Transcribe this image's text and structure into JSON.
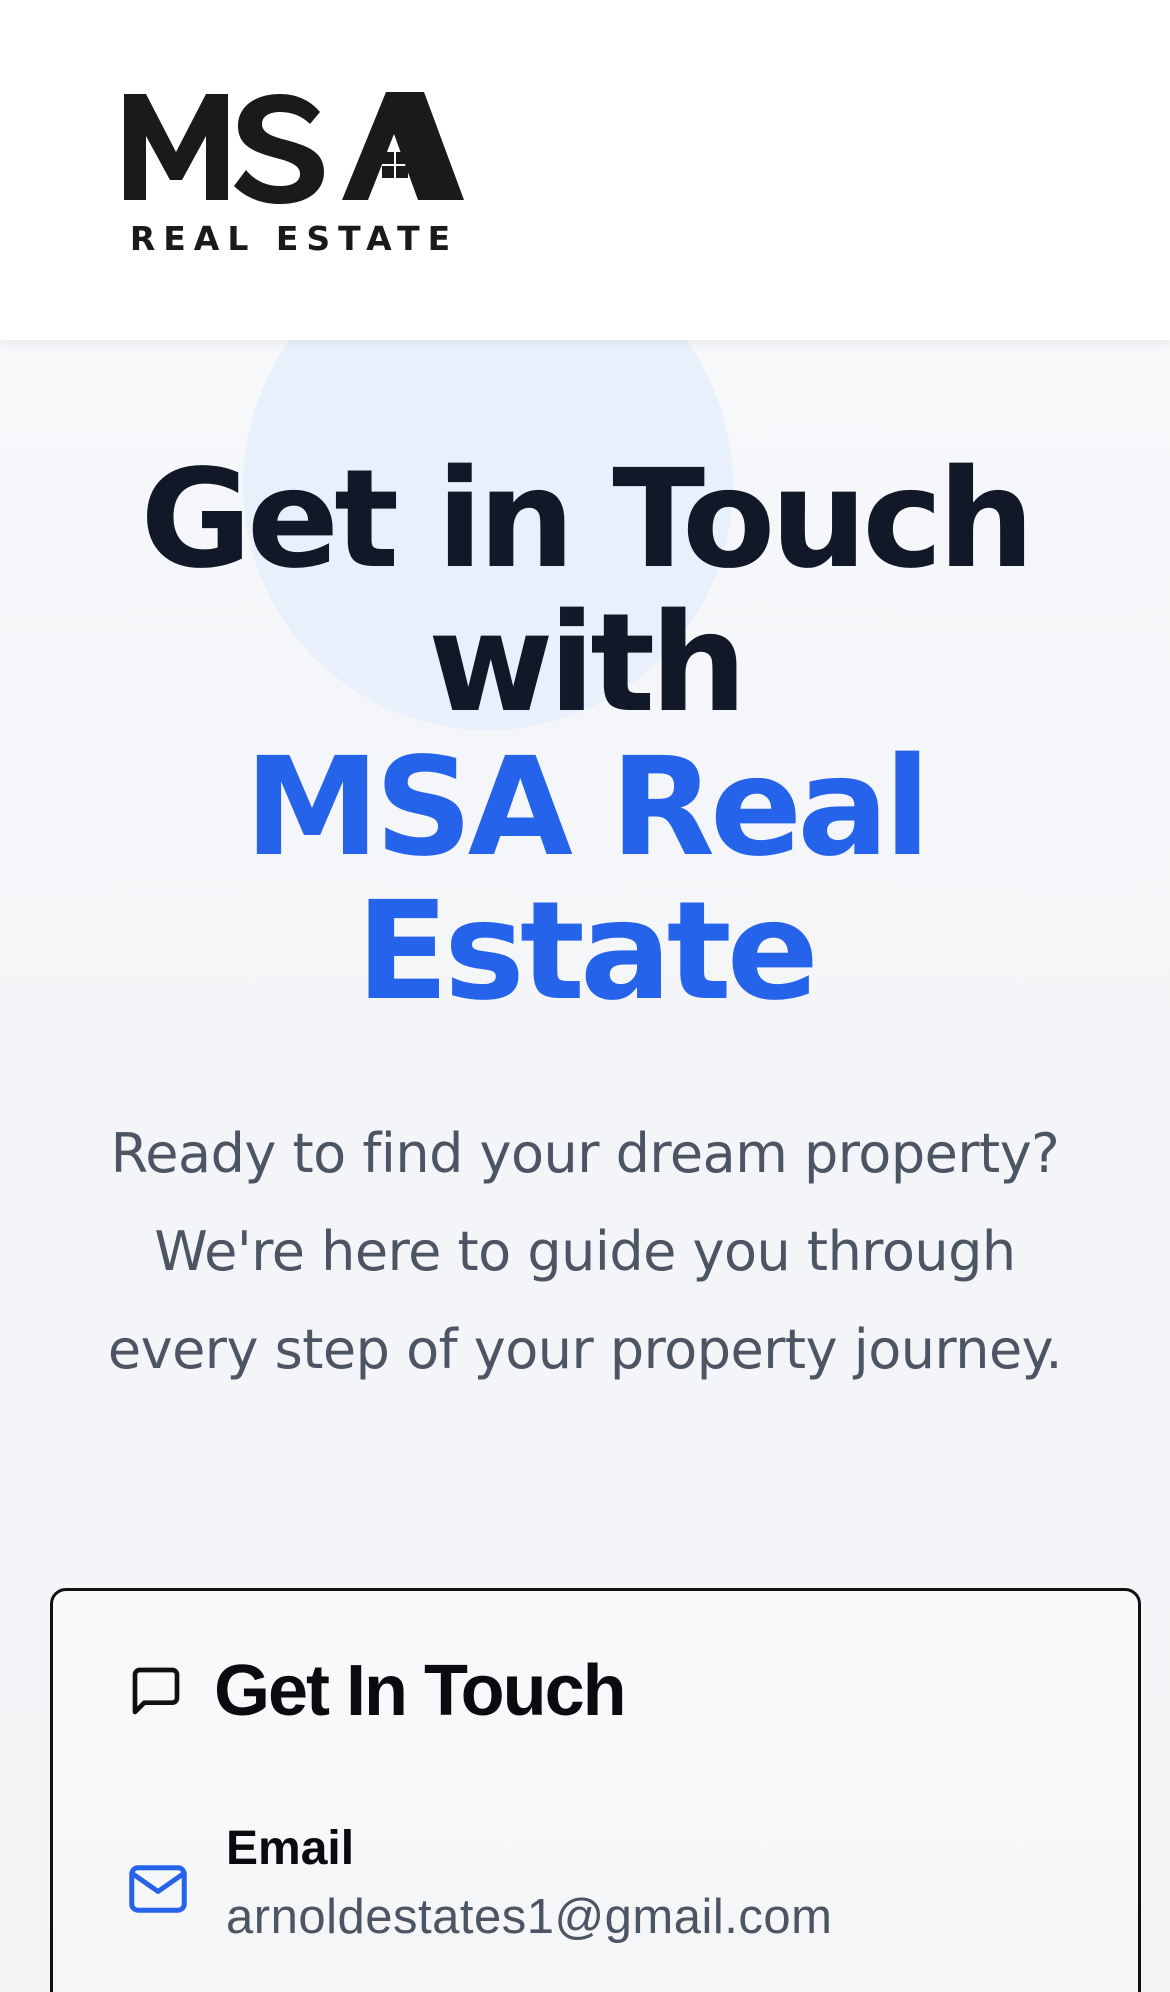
{
  "header": {
    "logo_text": "MSA",
    "logo_subtext": "REAL ESTATE"
  },
  "hero": {
    "title_line1": "Get in Touch",
    "title_line2": "with",
    "title_accent_line1": "MSA Real",
    "title_accent_line2": "Estate",
    "subtitle_line1": "Ready to find your dream property?",
    "subtitle_line2": "We're here to guide you through",
    "subtitle_line3": "every step of your property journey."
  },
  "contact_card": {
    "title": "Get In Touch",
    "title_icon": "chat-icon",
    "email": {
      "icon": "mail-icon",
      "label": "Email",
      "value": "arnoldestates1@gmail.com"
    }
  },
  "colors": {
    "accent": "#2563eb",
    "heading": "#111827",
    "body_text": "#4b5563",
    "hero_circle": "#e8f0fb"
  }
}
